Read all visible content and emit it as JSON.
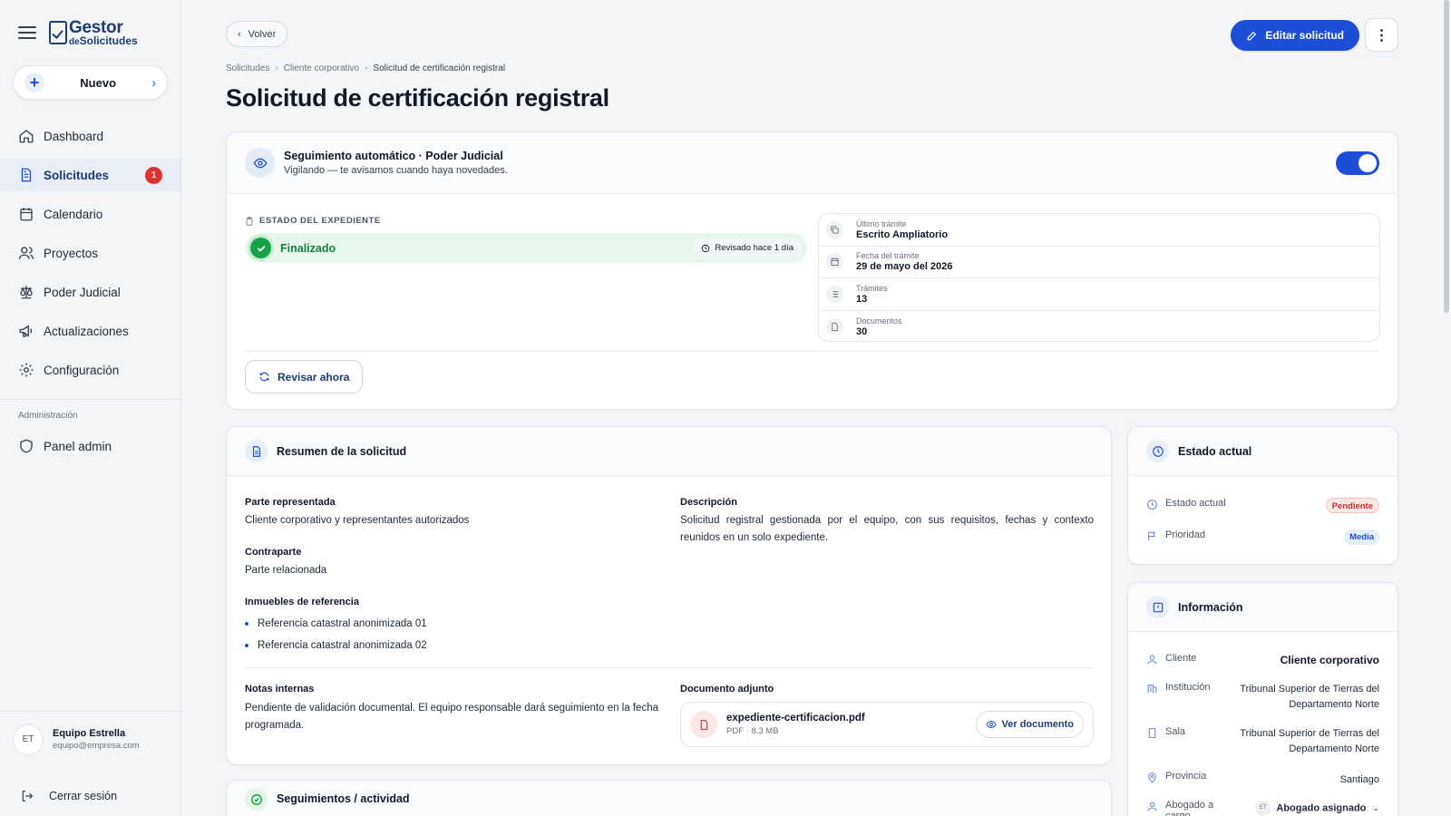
{
  "sidebar": {
    "logo": {
      "line1": "Gestor",
      "line2_prefix": "de",
      "line2": "Solicitudes"
    },
    "new_button": "Nuevo",
    "nav": [
      {
        "label": "Dashboard",
        "icon": "home-icon"
      },
      {
        "label": "Solicitudes",
        "icon": "document-icon",
        "badge": "1",
        "active": true
      },
      {
        "label": "Calendario",
        "icon": "calendar-icon"
      },
      {
        "label": "Proyectos",
        "icon": "users-icon"
      },
      {
        "label": "Poder Judicial",
        "icon": "scale-icon"
      },
      {
        "label": "Actualizaciones",
        "icon": "megaphone-icon"
      },
      {
        "label": "Configuración",
        "icon": "gear-icon"
      }
    ],
    "admin_section": "Administración",
    "admin_item": "Panel admin",
    "user": {
      "initials": "ET",
      "name": "Equipo Estrella",
      "email": "equipo@empresa.com"
    },
    "logout": "Cerrar sesión"
  },
  "header": {
    "back": "Volver",
    "edit": "Editar solicitud",
    "breadcrumb": [
      "Solicitudes",
      "Cliente corporativo",
      "Solicitud de certificación registral"
    ],
    "title": "Solicitud de certificación registral"
  },
  "tracking": {
    "title": "Seguimiento automático · Poder Judicial",
    "subtitle": "Vigilando — te avisamos cuando haya novedades.",
    "estado_label": "ESTADO DEL EXPEDIENTE",
    "estado": "Finalizado",
    "revisado": "Revisado hace 1 día",
    "stats": [
      {
        "label": "Último trámite",
        "value": "Escrito Ampliatorio"
      },
      {
        "label": "Fecha del trámite",
        "value": "29 de mayo del 2026"
      },
      {
        "label": "Trámites",
        "value": "13"
      },
      {
        "label": "Documentos",
        "value": "30"
      }
    ],
    "revisar": "Revisar ahora"
  },
  "summary": {
    "title": "Resumen de la solicitud",
    "parte_label": "Parte representada",
    "parte_value": "Cliente corporativo y representantes autorizados",
    "contraparte_label": "Contraparte",
    "contraparte_value": "Parte relacionada",
    "inmuebles_label": "Inmuebles de referencia",
    "inmuebles": [
      "Referencia catastral anonimizada 01",
      "Referencia catastral anonimizada 02"
    ],
    "descripcion_label": "Descripción",
    "descripcion_value": "Solicitud registral gestionada por el equipo, con sus requisitos, fechas y contexto reunidos en un solo expediente.",
    "notas_label": "Notas internas",
    "notas_value": "Pendiente de validación documental. El equipo responsable dará seguimiento en la fecha programada.",
    "doc_label": "Documento adjunto",
    "doc_name": "expediente-certificacion.pdf",
    "doc_meta": "PDF · 8.3 MB",
    "doc_button": "Ver documento"
  },
  "activity": {
    "title": "Seguimientos / actividad"
  },
  "estado_card": {
    "title": "Estado actual",
    "estado_label": "Estado actual",
    "estado_value": "Pendiente",
    "prioridad_label": "Prioridad",
    "prioridad_value": "Media"
  },
  "info_card": {
    "title": "Información",
    "cliente_label": "Cliente",
    "cliente_value": "Cliente corporativo",
    "institucion_label": "Institución",
    "institucion_value": "Tribunal Superior de Tierras del Departamento Norte",
    "sala_label": "Sala",
    "sala_value": "Tribunal Superior de Tierras del Departamento Norte",
    "provincia_label": "Provincia",
    "provincia_value": "Santiago",
    "abogado_label": "Abogado a cargo",
    "abogado_initials": "ET",
    "abogado_value": "Abogado asignado"
  },
  "colors": {
    "accent": "#1d4ed8",
    "success": "#16a34a",
    "danger": "#e03131"
  }
}
